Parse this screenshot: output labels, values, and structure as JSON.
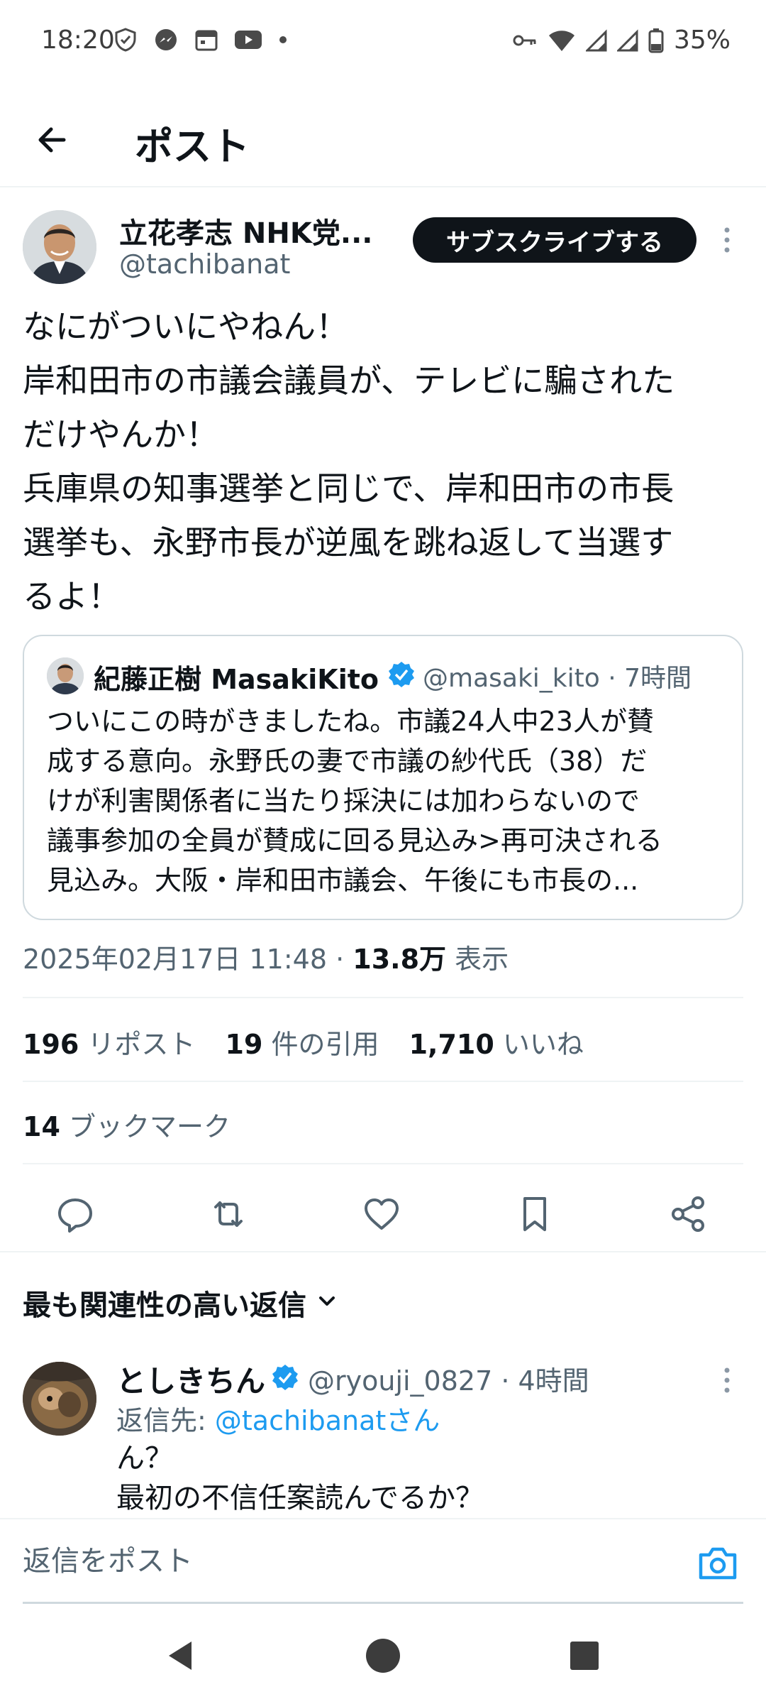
{
  "status_bar": {
    "time": "18:20",
    "battery": "35%",
    "left_icons": [
      "shield-icon",
      "messenger-icon",
      "calendar-icon",
      "youtube-icon",
      "dot-icon"
    ],
    "right_icons": [
      "key-icon",
      "wifi-icon",
      "signal-icon",
      "signal-icon",
      "battery-icon"
    ]
  },
  "header": {
    "title": "ポスト",
    "back_icon": "arrow-left-icon"
  },
  "post": {
    "author_name": "立花孝志 NHK党...",
    "author_handle": "@tachibanat",
    "subscribe_label": "サブスクライブする",
    "body": "なにがついにやねん！\n岸和田市の市議会議員が、テレビに騙された\nだけやんか！\n兵庫県の知事選挙と同じで、岸和田市の市長\n選挙も、永野市長が逆風を跳ね返して当選す\nるよ！",
    "quote": {
      "name": "紀藤正樹 MasakiKito",
      "meta": "@masaki_kito · 7時間",
      "text": "ついにこの時がきましたね。市議24人中23人が賛\n成する意向。永野氏の妻で市議の紗代氏（38）だ\nけが利害関係者に当たり採決には加わらないので\n議事参加の全員が賛成に回る見込み>再可決される\n見込み。大阪・岸和田市議会、午後にも市長の..."
    },
    "timestamp": "2025年02月17日 11:48 · ",
    "views_count": "13.8万",
    "views_label": " 表示",
    "reposts_count": "196",
    "reposts_label": " リポスト",
    "quotes_count": "19",
    "quotes_label": " 件の引用",
    "likes_count": "1,710",
    "likes_label": " いいね",
    "bookmarks_count": "14",
    "bookmarks_label": " ブックマーク"
  },
  "replies": {
    "sort_label": "最も関連性の高い返信",
    "items": [
      {
        "name": "としきちん",
        "meta": "@ryouji_0827 · 4時間",
        "reply_to_prefix": "返信先: ",
        "reply_to_handle": "@tachibanatさん",
        "text": "ん？\n最初の不信任案読んでるか？"
      }
    ]
  },
  "composer": {
    "placeholder": "返信をポスト"
  },
  "colors": {
    "text": "#0f1419",
    "secondary": "#536471",
    "accent": "#1d9bf0",
    "divider": "#eff3f4"
  }
}
